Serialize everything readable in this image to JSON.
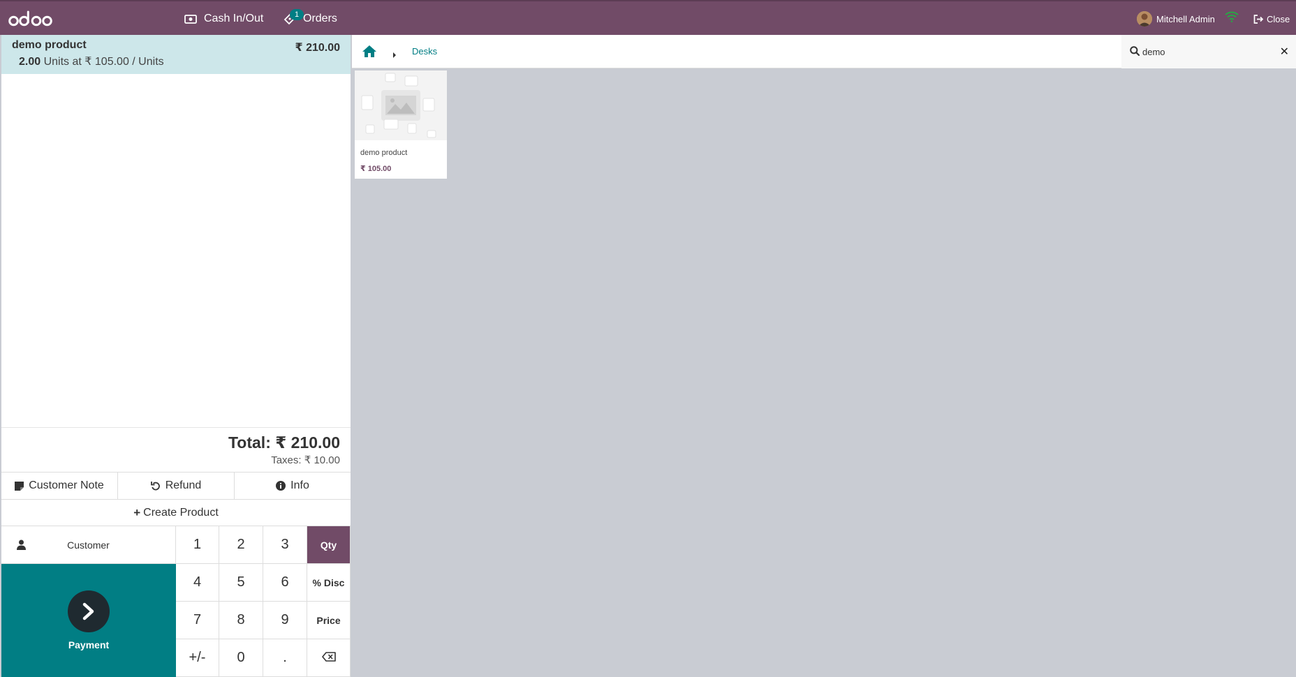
{
  "topbar": {
    "logo_text": "odoo",
    "cash_label": "Cash In/Out",
    "orders_label": "Orders",
    "orders_count": "1",
    "user_name": "Mitchell Admin",
    "close_label": "Close"
  },
  "order": {
    "lines": [
      {
        "name": "demo product",
        "price": "₹ 210.00",
        "qty": "2.00",
        "detail": "Units at ₹ 105.00 / Units"
      }
    ],
    "total": "Total: ₹ 210.00",
    "taxes": "Taxes: ₹ 10.00"
  },
  "controls": {
    "customer_note": "Customer Note",
    "refund": "Refund",
    "info": "Info",
    "create_product": "Create Product"
  },
  "actionpad": {
    "customer": "Customer",
    "payment": "Payment"
  },
  "numpad": {
    "keys": [
      "1",
      "2",
      "3",
      "Qty",
      "4",
      "5",
      "6",
      "% Disc",
      "7",
      "8",
      "9",
      "Price",
      "+/-",
      "0",
      ".",
      ""
    ],
    "active_mode": "Qty"
  },
  "products_bar": {
    "breadcrumb": "Desks",
    "search_value": "demo"
  },
  "products": [
    {
      "name": "demo product",
      "price": "₹ 105.00"
    }
  ],
  "colors": {
    "brand": "#714b67",
    "accent": "#017e84",
    "selected_line": "#cde7ea",
    "background": "#c9ccd3"
  }
}
